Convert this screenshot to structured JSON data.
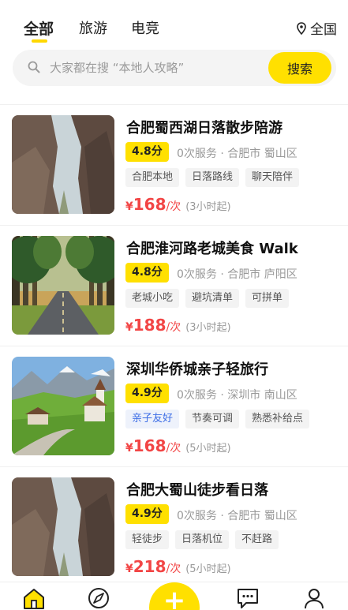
{
  "tabs": [
    {
      "label": "全部",
      "active": true
    },
    {
      "label": "旅游",
      "active": false
    },
    {
      "label": "电竞",
      "active": false
    }
  ],
  "region": {
    "label": "全国",
    "icon": "location-pin-icon"
  },
  "search": {
    "placeholder": "大家都在搜 “本地人攻略”",
    "button_label": "搜索",
    "icon": "search-icon"
  },
  "listings": [
    {
      "title": "合肥蜀西湖日落散步陪游",
      "rating": "4.8分",
      "meta": "0次服务 · 合肥市 蜀山区",
      "tags": [
        {
          "label": "合肥本地",
          "style": "plain"
        },
        {
          "label": "日落路线",
          "style": "plain"
        },
        {
          "label": "聊天陪伴",
          "style": "plain"
        }
      ],
      "currency": "¥",
      "price": "168",
      "unit": "/次",
      "duration": "(3小时起)",
      "image": "rocky-canyon"
    },
    {
      "title": "合肥淮河路老城美食 Walk",
      "rating": "4.8分",
      "meta": "0次服务 · 合肥市 庐阳区",
      "tags": [
        {
          "label": "老城小吃",
          "style": "plain"
        },
        {
          "label": "避坑清单",
          "style": "plain"
        },
        {
          "label": "可拼单",
          "style": "plain"
        }
      ],
      "currency": "¥",
      "price": "188",
      "unit": "/次",
      "duration": "(3小时起)",
      "image": "forest-road"
    },
    {
      "title": "深圳华侨城亲子轻旅行",
      "rating": "4.9分",
      "meta": "0次服务 · 深圳市 南山区",
      "tags": [
        {
          "label": "亲子友好",
          "style": "blue"
        },
        {
          "label": "节奏可调",
          "style": "plain"
        },
        {
          "label": "熟悉补给点",
          "style": "plain"
        }
      ],
      "currency": "¥",
      "price": "168",
      "unit": "/次",
      "duration": "(5小时起)",
      "image": "alpine-village"
    },
    {
      "title": "合肥大蜀山徒步看日落",
      "rating": "4.9分",
      "meta": "0次服务 · 合肥市 蜀山区",
      "tags": [
        {
          "label": "轻徒步",
          "style": "plain"
        },
        {
          "label": "日落机位",
          "style": "plain"
        },
        {
          "label": "不赶路",
          "style": "plain"
        }
      ],
      "currency": "¥",
      "price": "218",
      "unit": "/次",
      "duration": "(5小时起)",
      "image": "rocky-canyon"
    }
  ],
  "bottom_nav": [
    {
      "name": "home-icon",
      "active": true
    },
    {
      "name": "explore-icon",
      "active": false
    },
    {
      "name": "add-icon",
      "label": "+"
    },
    {
      "name": "message-icon",
      "active": false
    },
    {
      "name": "profile-icon",
      "active": false
    }
  ],
  "colors": {
    "accent": "#ffe000",
    "price": "#f24545",
    "tag_blue": "#3d6ee6"
  }
}
